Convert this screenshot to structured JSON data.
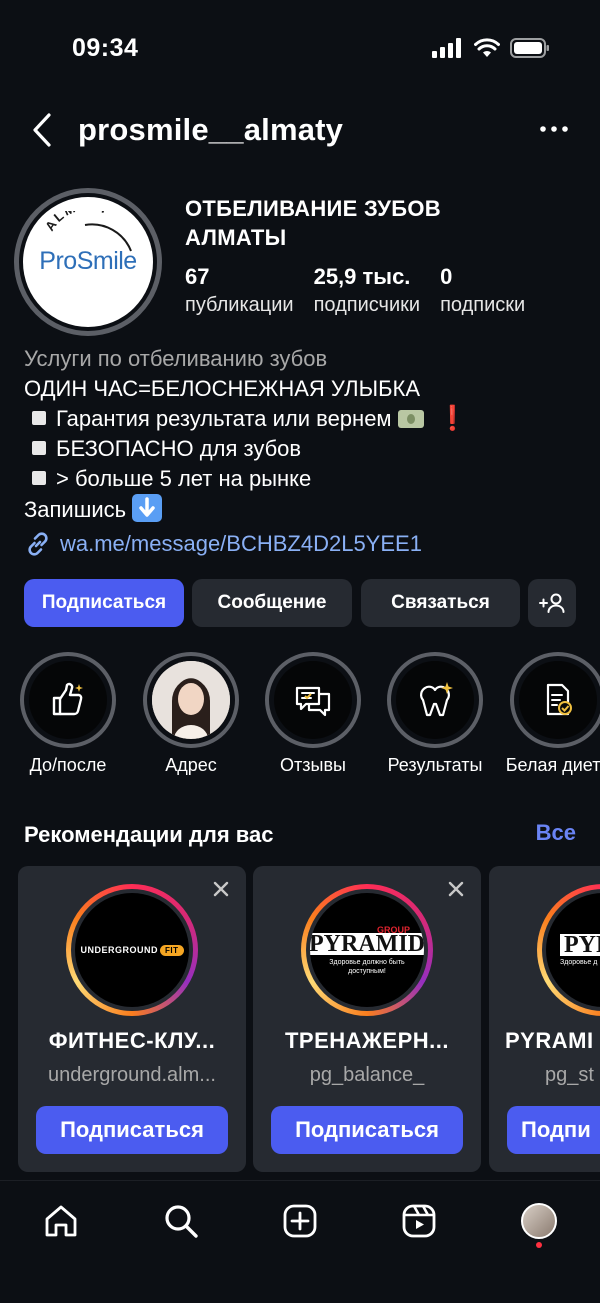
{
  "status_bar": {
    "time": "09:34"
  },
  "header": {
    "username": "prosmile__almaty"
  },
  "profile": {
    "avatar_logo": {
      "arc_text": "ALMATY",
      "pro": "Pro",
      "smile": "Smile"
    },
    "name_line1": "ОТБЕЛИВАНИЕ ЗУБОВ",
    "name_line2": "АЛМАТЫ",
    "stats": [
      {
        "value": "67",
        "label": "публикации"
      },
      {
        "value": "25,9 тыс.",
        "label": "подписчики"
      },
      {
        "value": "0",
        "label": "подписки"
      }
    ]
  },
  "bio": {
    "category": "Услуги по отбеливанию зубов",
    "line1": "ОДИН ЧАС=БЕЛОСНЕЖНАЯ УЛЫБКА",
    "bullet1": "Гарантия результата или вернем",
    "bullet2": "БЕЗОПАСНО для зубов",
    "bullet3": "> больше 5 лет на рынке",
    "cta": "Запишись",
    "link": "wa.me/message/BCHBZ4D2L5YEE1"
  },
  "actions": {
    "follow": "Подписаться",
    "message": "Сообщение",
    "contact": "Связаться"
  },
  "highlights": [
    {
      "label": "До/после",
      "icon": "thumbs-up-icon"
    },
    {
      "label": "Адрес",
      "icon": "person-photo"
    },
    {
      "label": "Отзывы",
      "icon": "chat-bubbles-icon"
    },
    {
      "label": "Результаты",
      "icon": "tooth-sparkle-icon"
    },
    {
      "label": "Белая диета",
      "icon": "document-check-icon"
    }
  ],
  "recommendations": {
    "title": "Рекомендации для вас",
    "see_all": "Все",
    "cards": [
      {
        "name": "ФИТНЕС-КЛУ...",
        "handle": "underground.alm...",
        "follow": "Подписаться",
        "logo_text": "UNDERGROUND",
        "logo_badge": "FIT"
      },
      {
        "name": "ТРЕНАЖЕРН...",
        "handle": "pg_balance_",
        "follow": "Подписаться",
        "logo_text": "PYRAMID",
        "logo_group": "GROUP",
        "logo_sub1": "Здоровье должно быть",
        "logo_sub2": "доступным!"
      },
      {
        "name": "PYRAMI",
        "handle": "pg_st",
        "follow": "Подпи",
        "logo_text": "PYR",
        "logo_sub1": "Здоровье д"
      }
    ]
  },
  "colors": {
    "background": "#0c0f14",
    "primary": "#4b5cf0",
    "secondary_button": "#262a31",
    "link": "#8ab0f5"
  }
}
